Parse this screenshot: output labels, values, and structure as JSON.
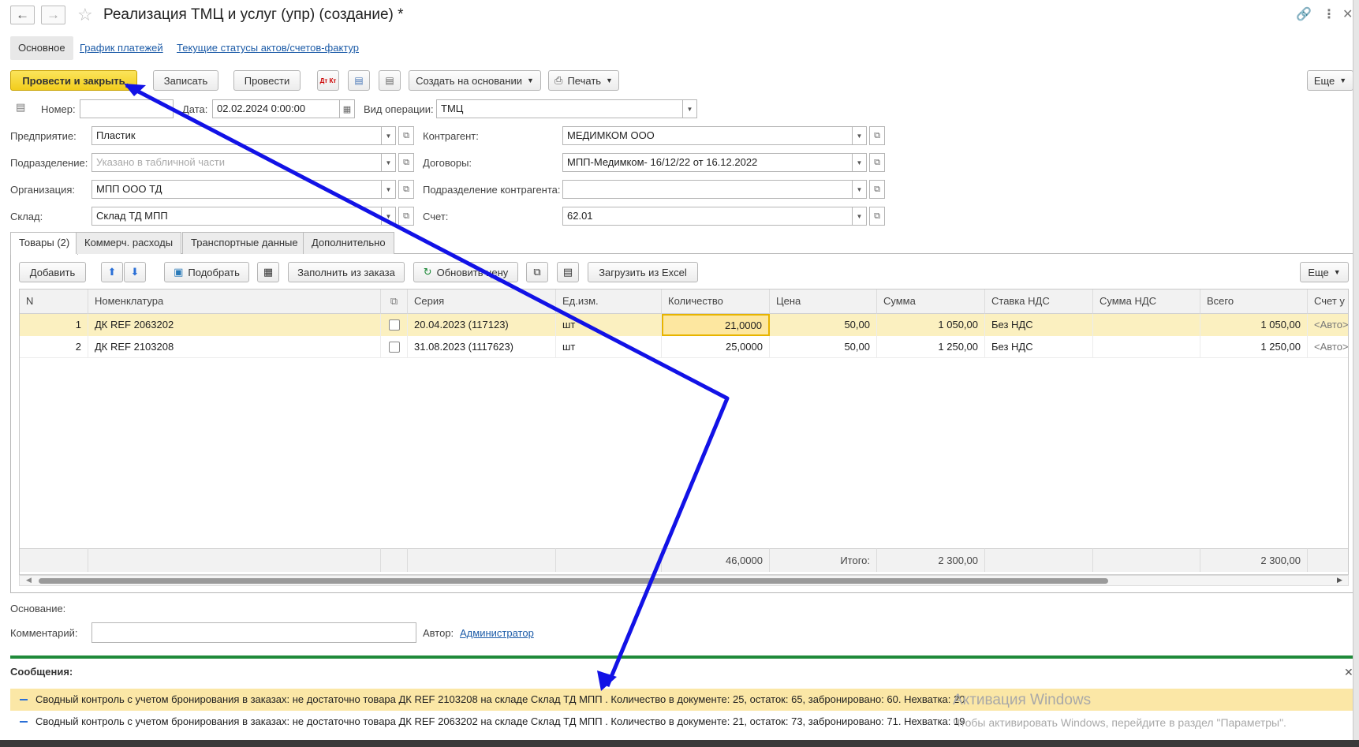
{
  "window": {
    "title": "Реализация ТМЦ и услуг (упр) (создание) *"
  },
  "section_tabs": [
    {
      "label": "Основное"
    },
    {
      "label": "График платежей"
    },
    {
      "label": "Текущие статусы актов/счетов-фактур"
    }
  ],
  "toolbar": {
    "post_close": "Провести и закрыть",
    "save": "Записать",
    "post": "Провести",
    "create_based": "Создать на основании",
    "print": "Печать",
    "more": "Еще",
    "dtkt_icon_label": "Дт Кт"
  },
  "header": {
    "number_label": "Номер:",
    "number_value": "",
    "date_label": "Дата:",
    "date_value": "02.02.2024  0:00:00",
    "op_label": "Вид операции:",
    "op_value": "ТМЦ",
    "enterprise_label": "Предприятие:",
    "enterprise_value": "Пластик",
    "division_label": "Подразделение:",
    "division_placeholder": "Указано в табличной части",
    "org_label": "Организация:",
    "org_value": "МПП ООО ТД",
    "warehouse_label": "Склад:",
    "warehouse_value": "Склад ТД МПП",
    "counterparty_label": "Контрагент:",
    "counterparty_value": "МЕДИМКОМ ООО",
    "contracts_label": "Договоры:",
    "contracts_value": "МПП-Медимком- 16/12/22 от 16.12.2022",
    "cp_division_label": "Подразделение контрагента:",
    "cp_division_value": "",
    "account_label": "Счет:",
    "account_value": "62.01"
  },
  "page_tabs": [
    {
      "label": "Товары (2)"
    },
    {
      "label": "Коммерч. расходы"
    },
    {
      "label": "Транспортные данные"
    },
    {
      "label": "Дополнительно"
    }
  ],
  "table_toolbar": {
    "add": "Добавить",
    "pick": "Подобрать",
    "fill_from_order": "Заполнить из заказа",
    "update_price": "Обновить цену",
    "load_excel": "Загрузить из Excel",
    "more": "Еще"
  },
  "table": {
    "columns": [
      "N",
      "Номенклатура",
      "",
      "Серия",
      "Ед.изм.",
      "Количество",
      "Цена",
      "Сумма",
      "Ставка НДС",
      "Сумма НДС",
      "Всего",
      "Счет у"
    ],
    "rows": [
      {
        "n": "1",
        "item": "ДК REF 2063202",
        "series": "20.04.2023 (117123)",
        "unit": "шт",
        "qty": "21,0000",
        "price": "50,00",
        "sum": "1 050,00",
        "vat_rate": "Без НДС",
        "vat_sum": "",
        "total": "1 050,00",
        "account": "<Авто>"
      },
      {
        "n": "2",
        "item": "ДК REF 2103208",
        "series": "31.08.2023 (1117623)",
        "unit": "шт",
        "qty": "25,0000",
        "price": "50,00",
        "sum": "1 250,00",
        "vat_rate": "Без НДС",
        "vat_sum": "",
        "total": "1 250,00",
        "account": "<Авто>"
      }
    ],
    "footer": {
      "qty_total": "46,0000",
      "itogo_label": "Итого:",
      "sum_total": "2 300,00",
      "total_total": "2 300,00"
    }
  },
  "bottom": {
    "basis_label": "Основание:",
    "comment_label": "Комментарий:",
    "comment_value": "",
    "author_label": "Автор:",
    "author_value": "Администратор"
  },
  "messages": {
    "title": "Сообщения:",
    "items": [
      "Сводный контроль с учетом бронирования в заказах: не достаточно товара ДК REF 2103208 на складе Склад ТД МПП . Количество в документе: 25, остаток: 65, забронировано: 60. Нехватка: 20",
      "Сводный контроль с учетом бронирования в заказах: не достаточно товара ДК REF 2063202  на складе Склад ТД МПП . Количество в документе: 21, остаток: 73, забронировано: 71. Нехватка: 19"
    ]
  },
  "watermark": {
    "line1": "Активация Windows",
    "line2": "Чтобы активировать Windows, перейдите в раздел \"Параметры\"."
  },
  "colors": {
    "primary_button": "#f2cd1c",
    "selected_row": "#fbf0c0",
    "annotation_arrow": "#1212e6",
    "messages_bar": "#1f8a3a",
    "link": "#1d5ca8"
  }
}
